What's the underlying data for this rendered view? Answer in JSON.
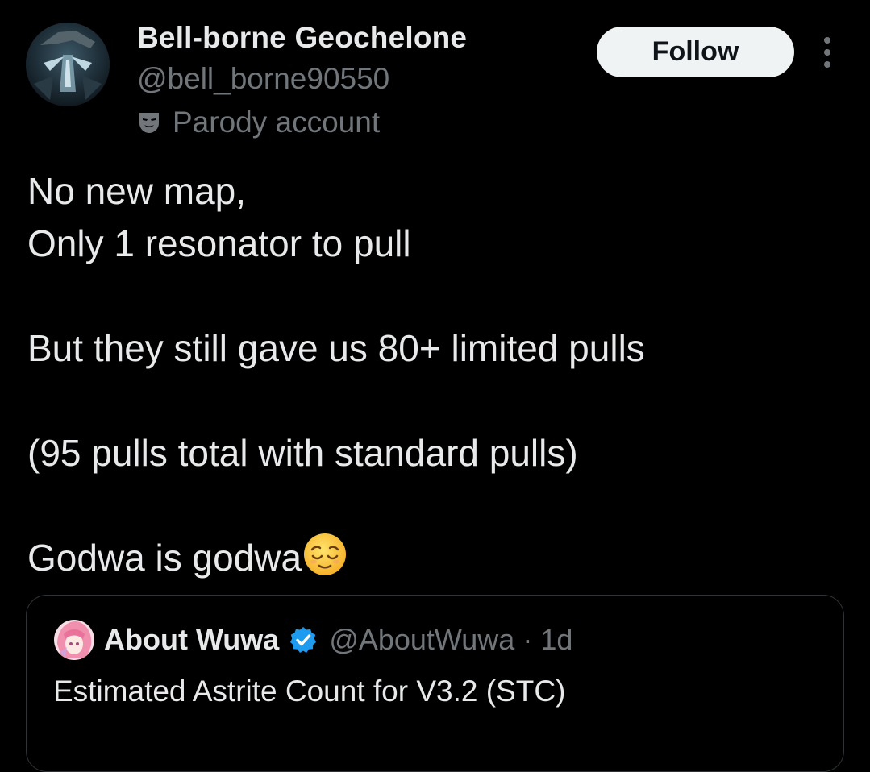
{
  "author": {
    "display_name": "Bell-borne Geochelone",
    "handle": "@bell_borne90550",
    "parody_label": "Parody account"
  },
  "actions": {
    "follow_label": "Follow"
  },
  "tweet": {
    "lines": [
      "No new map,",
      "Only 1 resonator to pull",
      "",
      "But they still gave us 80+ limited pulls",
      "",
      "(95 pulls total with standard pulls)",
      "",
      "Godwa is godwa"
    ],
    "trailing_emoji": "relieved-face"
  },
  "quoted_tweet": {
    "display_name": "About Wuwa",
    "handle": "@AboutWuwa",
    "separator": "·",
    "time": "1d",
    "text": "Estimated Astrite Count for V3.2 (STC)",
    "verified": true
  },
  "colors": {
    "background": "#000000",
    "primary_text": "#e7e9ea",
    "secondary_text": "#71767b",
    "border": "#2f3336",
    "follow_bg": "#eff3f4",
    "verified_blue": "#1d9bf0"
  }
}
